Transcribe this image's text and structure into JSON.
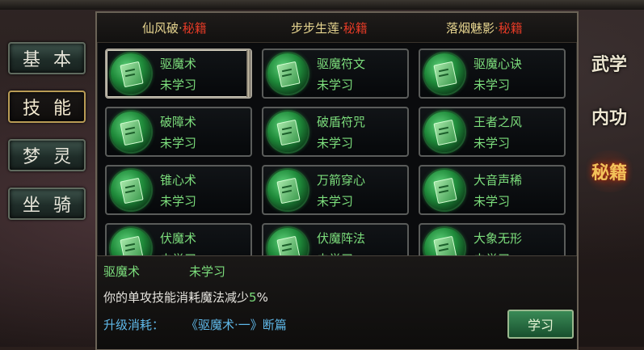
{
  "left_tabs": [
    {
      "label": "基本",
      "active": false
    },
    {
      "label": "技能",
      "active": true
    },
    {
      "label": "梦灵",
      "active": false
    },
    {
      "label": "坐骑",
      "active": false
    }
  ],
  "header_tabs": [
    {
      "name": "仙风破",
      "sep": "·",
      "tag": "秘籍"
    },
    {
      "name": "步步生莲",
      "sep": "·",
      "tag": "秘籍"
    },
    {
      "name": "落烟魅影",
      "sep": "·",
      "tag": "秘籍"
    }
  ],
  "skills": [
    {
      "name": "驱魔术",
      "status": "未学习"
    },
    {
      "name": "驱魔符文",
      "status": "未学习"
    },
    {
      "name": "驱魔心诀",
      "status": "未学习"
    },
    {
      "name": "破障术",
      "status": "未学习"
    },
    {
      "name": "破盾符咒",
      "status": "未学习"
    },
    {
      "name": "王者之风",
      "status": "未学习"
    },
    {
      "name": "锥心术",
      "status": "未学习"
    },
    {
      "name": "万箭穿心",
      "status": "未学习"
    },
    {
      "name": "大音声稀",
      "status": "未学习"
    },
    {
      "name": "伏魔术",
      "status": "未学习"
    },
    {
      "name": "伏魔阵法",
      "status": "未学习"
    },
    {
      "name": "大象无形",
      "status": "未学习"
    }
  ],
  "info": {
    "selected_name": "驱魔术",
    "selected_status": "未学习",
    "desc_prefix": "你的单攻技能消耗魔法减少",
    "desc_value": "5",
    "desc_suffix": "%",
    "cost_label": "升级消耗：",
    "cost_value": "《驱魔术·一》断篇",
    "learn_button": "学习"
  },
  "right_tabs": [
    {
      "label": "武学",
      "active": false
    },
    {
      "label": "内功",
      "active": false
    },
    {
      "label": "秘籍",
      "active": true
    }
  ],
  "colors": {
    "skill_text": "#7cde7c",
    "tag_red": "#e33a26",
    "cost_blue": "#5fb8e8",
    "header_gold": "#e8d690"
  }
}
